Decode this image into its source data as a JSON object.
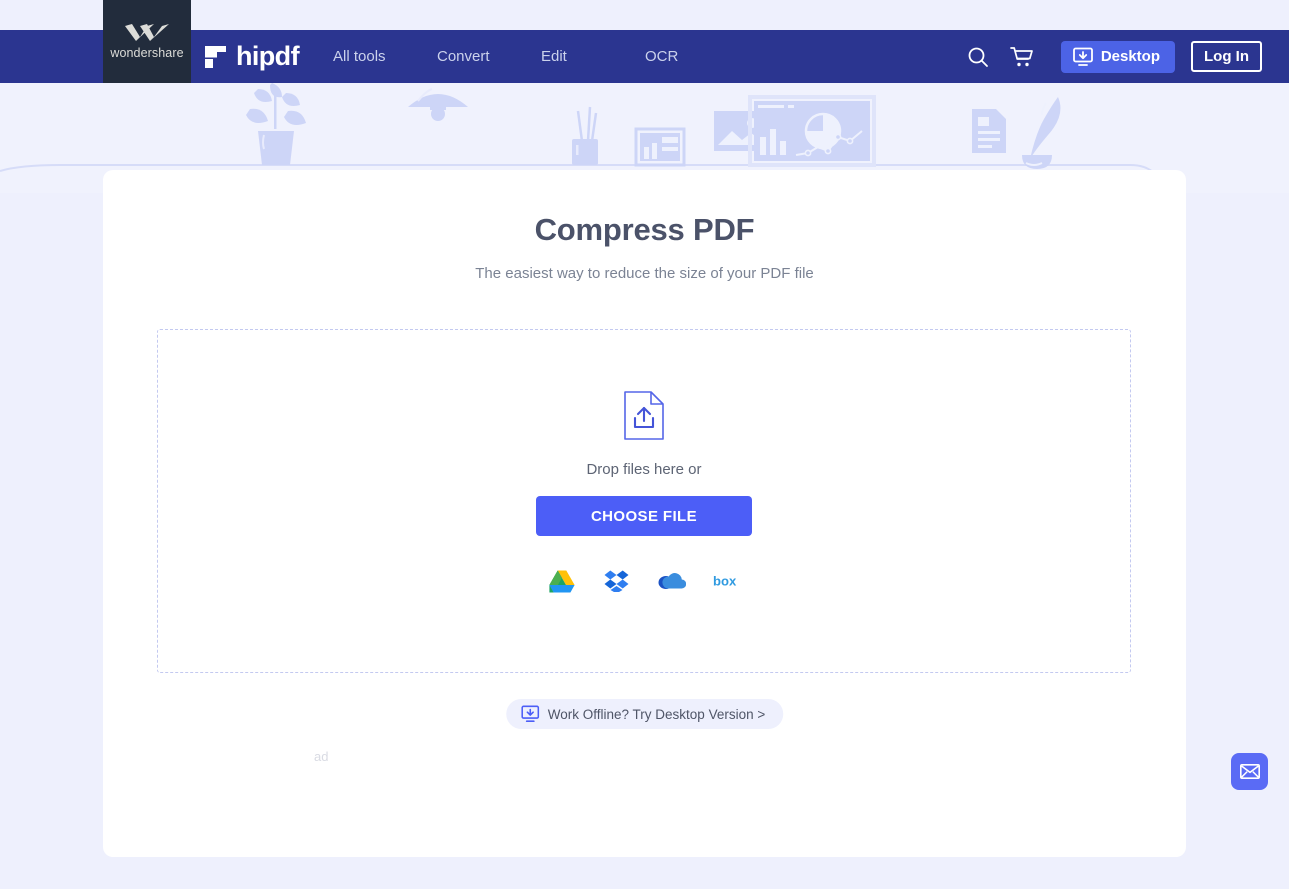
{
  "brand": {
    "vendor_name": "wondershare",
    "product_name": "hipdf",
    "vendor_mark_icon": "wondershare-w-icon",
    "product_mark_icon": "hipdf-logo-icon"
  },
  "nav": {
    "links": [
      {
        "label": "All tools"
      },
      {
        "label": "Convert"
      },
      {
        "label": "Edit"
      },
      {
        "label": "OCR"
      }
    ],
    "search_icon": "search-icon",
    "cart_icon": "shopping-cart-icon",
    "desktop_button": {
      "label": "Desktop",
      "icon": "monitor-download-icon",
      "bg_color": "#4c63e6"
    },
    "login_button": {
      "label": "Log In"
    }
  },
  "hero": {
    "illustration_items": [
      "potted-plant-icon",
      "hanging-lamp-icon",
      "pencil-cup-icon",
      "framed-chart-icon",
      "picture-frame-icon",
      "monitor-dashboard-icon",
      "document-icon",
      "quill-pen-icon"
    ],
    "bg_color": "#f0f2fd"
  },
  "main": {
    "title": "Compress PDF",
    "subtitle": "The easiest way to reduce the size of your PDF file",
    "dropzone": {
      "upload_icon": "file-upload-icon",
      "drop_text": "Drop files here or",
      "choose_file_label": "CHOOSE FILE",
      "choose_file_color": "#4c5ef7",
      "cloud_sources": [
        {
          "name": "google-drive-icon",
          "label": "Google Drive"
        },
        {
          "name": "dropbox-icon",
          "label": "Dropbox"
        },
        {
          "name": "onedrive-icon",
          "label": "OneDrive"
        },
        {
          "name": "box-icon",
          "label": "Box"
        }
      ]
    },
    "offline_pill": {
      "label": "Work Offline? Try Desktop Version >",
      "icon": "monitor-download-icon"
    },
    "ad_label": "ad"
  },
  "widgets": {
    "mail_icon": "envelope-icon",
    "mail_color": "#5a6bf5"
  },
  "theme": {
    "page_bg": "#eef0fd",
    "navbar_bg": "#2b3590",
    "vendor_badge_bg": "#222c3c",
    "card_bg": "#ffffff",
    "title_color": "#4b5269"
  }
}
